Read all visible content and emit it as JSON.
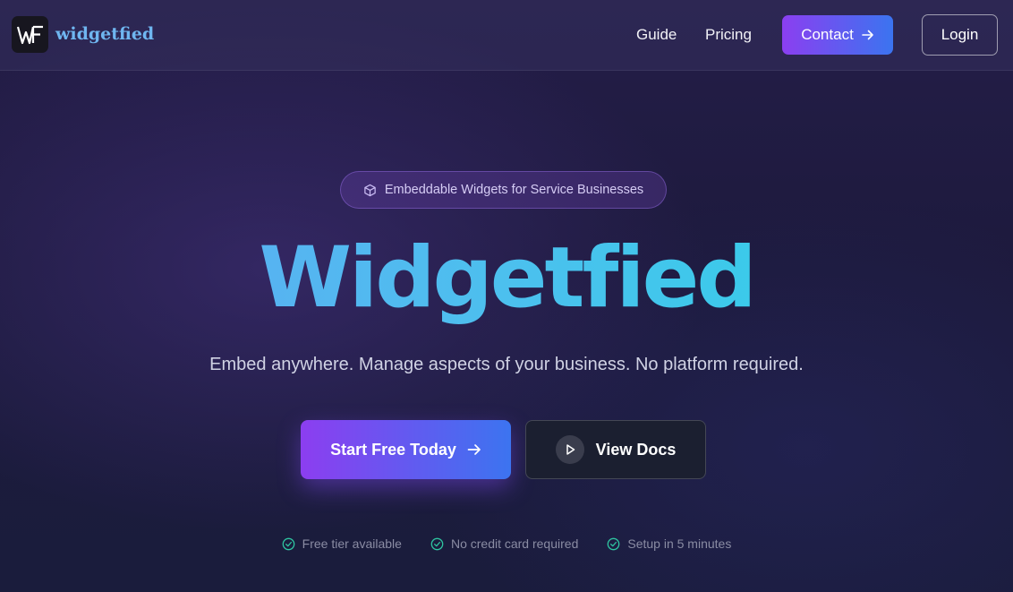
{
  "brand": {
    "logo_mark": "WF",
    "name": "widgetfied"
  },
  "nav": {
    "guide": "Guide",
    "pricing": "Pricing",
    "contact": "Contact",
    "login": "Login"
  },
  "hero": {
    "badge": "Embeddable Widgets for Service Businesses",
    "title": "Widgetfied",
    "subtitle": "Embed anywhere. Manage aspects of your business. No platform required.",
    "primary_cta": "Start Free Today",
    "secondary_cta": "View Docs"
  },
  "features": [
    {
      "label": "Free tier available",
      "icon": "check-circle-icon"
    },
    {
      "label": "No credit card required",
      "icon": "check-circle-icon"
    },
    {
      "label": "Setup in 5 minutes",
      "icon": "check-circle-icon"
    }
  ],
  "colors": {
    "accent_start": "#8b3ff0",
    "accent_end": "#3b74f0",
    "title_gradient_start": "#62a6f4",
    "title_gradient_end": "#2ad4e6",
    "check_green": "#2ec4a0"
  }
}
